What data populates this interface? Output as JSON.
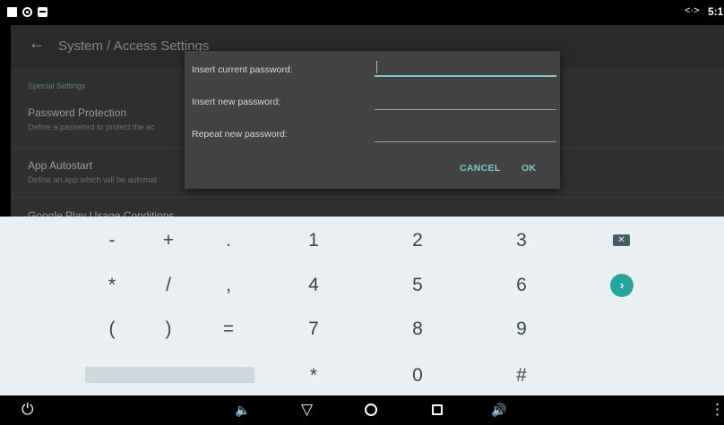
{
  "status_bar": {
    "time": "5:1",
    "icons": [
      "notification-square-icon",
      "eye-icon",
      "store-icon",
      "data-arrows-icon"
    ],
    "data_arrows": "<·>"
  },
  "app": {
    "back_glyph": "←",
    "title": "System / Access Settings",
    "section_header": "Special Settings",
    "prefs": [
      {
        "title": "Password Protection",
        "subtitle": "Define a password to protect the ac"
      },
      {
        "title": "App Autostart",
        "subtitle": "Define an app which will be automat"
      },
      {
        "title": "Google Play Usage Conditions",
        "subtitle": ""
      }
    ]
  },
  "dialog": {
    "labels": [
      "Insert current password:",
      "Insert new password:",
      "Repeat new password:"
    ],
    "values": [
      "",
      "",
      ""
    ],
    "cancel_label": "CANCEL",
    "ok_label": "OK"
  },
  "keyboard": {
    "rows": [
      [
        "-",
        "+",
        ".",
        "1",
        "2",
        "3"
      ],
      [
        "*",
        "/",
        ",",
        "4",
        "5",
        "6"
      ],
      [
        "(",
        ")",
        "=",
        "7",
        "8",
        "9"
      ],
      [
        "*",
        "0",
        "#"
      ]
    ],
    "delete_glyph": "✕",
    "go_glyph": "›"
  },
  "nav_bar": {
    "power": "⏻",
    "vol_down": "🔈",
    "back": "▽",
    "vol_up": "🔊",
    "menu": "⋮"
  },
  "colors": {
    "accent": "#80cbc4",
    "go_button": "#26a69a",
    "dialog_bg": "#424242",
    "keyboard_bg": "#eceff1"
  }
}
